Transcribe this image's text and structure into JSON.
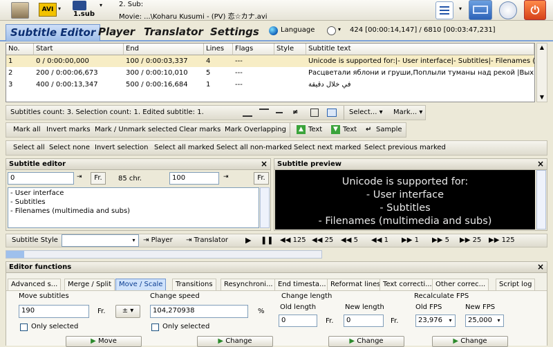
{
  "file": {
    "movie_label": "1.sub",
    "sub_line": "2. Sub:",
    "movie_line": "Movie: ...\\Koharu Kusumi - (PV) 恋☆カナ.avi"
  },
  "tabs": [
    "Subtitle Editor",
    "Player",
    "Translator",
    "Settings"
  ],
  "language_label": "Language",
  "time_readout": "424 [00:00:14,147] / 6810 [00:03:47,231]",
  "grid": {
    "headers": [
      "No.",
      "Start",
      "End",
      "Lines",
      "Flags",
      "Style",
      "Subtitle text"
    ],
    "rows": [
      {
        "no": "1",
        "start": "0 / 0:00:00,000",
        "end": "100 / 0:00:03,337",
        "lines": "4",
        "flags": "---",
        "style": "",
        "text": "Unicode is supported for:|- User interface|- Subtitles|- Filenames (..."
      },
      {
        "no": "2",
        "start": "200 / 0:00:06,673",
        "end": "300 / 0:00:10,010",
        "lines": "5",
        "flags": "---",
        "style": "",
        "text": "Расцветали яблони и груши,Поплыли туманы над рекой |Вых..."
      },
      {
        "no": "3",
        "start": "400 / 0:00:13,347",
        "end": "500 / 0:00:16,684",
        "lines": "1",
        "flags": "---",
        "style": "",
        "text": "في خلال دقيقة"
      }
    ]
  },
  "status": {
    "text": "Subtitles count: 3.  Selection count: 1.  Edited subtitle: 1.",
    "select_menu": "Select...",
    "mark_menu": "Mark..."
  },
  "mark_buttons": [
    "Mark all",
    "Invert marks",
    "Mark / Unmark selected",
    "Clear marks",
    "Mark Overlapping"
  ],
  "text_buttons": [
    "Text",
    "Text",
    "Sample"
  ],
  "select_buttons": [
    "Select all",
    "Select none",
    "Invert selection",
    "Select all marked",
    "Select all non-marked",
    "Select next marked",
    "Select previous marked"
  ],
  "editor": {
    "title": "Subtitle editor",
    "start_value": "0",
    "fr_label": "Fr.",
    "chars": "85 chr.",
    "end_value": "100",
    "text_lines": [
      "- User interface",
      "- Subtitles",
      "- Filenames (multimedia and subs)"
    ]
  },
  "preview": {
    "title": "Subtitle preview",
    "lines": [
      "Unicode is supported for:",
      "- User interface",
      "- Subtitles",
      "- Filenames (multimedia and subs)"
    ]
  },
  "style_bar": {
    "label": "Subtitle Style",
    "player": "Player",
    "translator": "Translator",
    "seeks": [
      "125",
      "25",
      "5",
      "1",
      "1",
      "5",
      "25",
      "125"
    ]
  },
  "functions": {
    "title": "Editor functions",
    "tabs": [
      "Advanced s...",
      "Merge / Split",
      "Move / Scale",
      "Transitions",
      "Resynchroni...",
      "End timesta...",
      "Reformat lines",
      "Text correcti...",
      "Other correc...",
      "Script log"
    ],
    "move_label": "Move subtitles",
    "move_value": "190",
    "fr": "Fr.",
    "sign": "±",
    "only_selected": "Only selected",
    "speed_label": "Change speed",
    "speed_value": "104,270938",
    "percent": "%",
    "length_label": "Change length",
    "old_length_label": "Old length",
    "old_length_value": "0",
    "new_length_label": "New length",
    "new_length_value": "0",
    "fps_label": "Recalculate FPS",
    "old_fps_label": "Old FPS",
    "old_fps_value": "23,976",
    "new_fps_label": "New FPS",
    "new_fps_value": "25,000",
    "move_btn": "Move",
    "change_btn": "Change"
  }
}
